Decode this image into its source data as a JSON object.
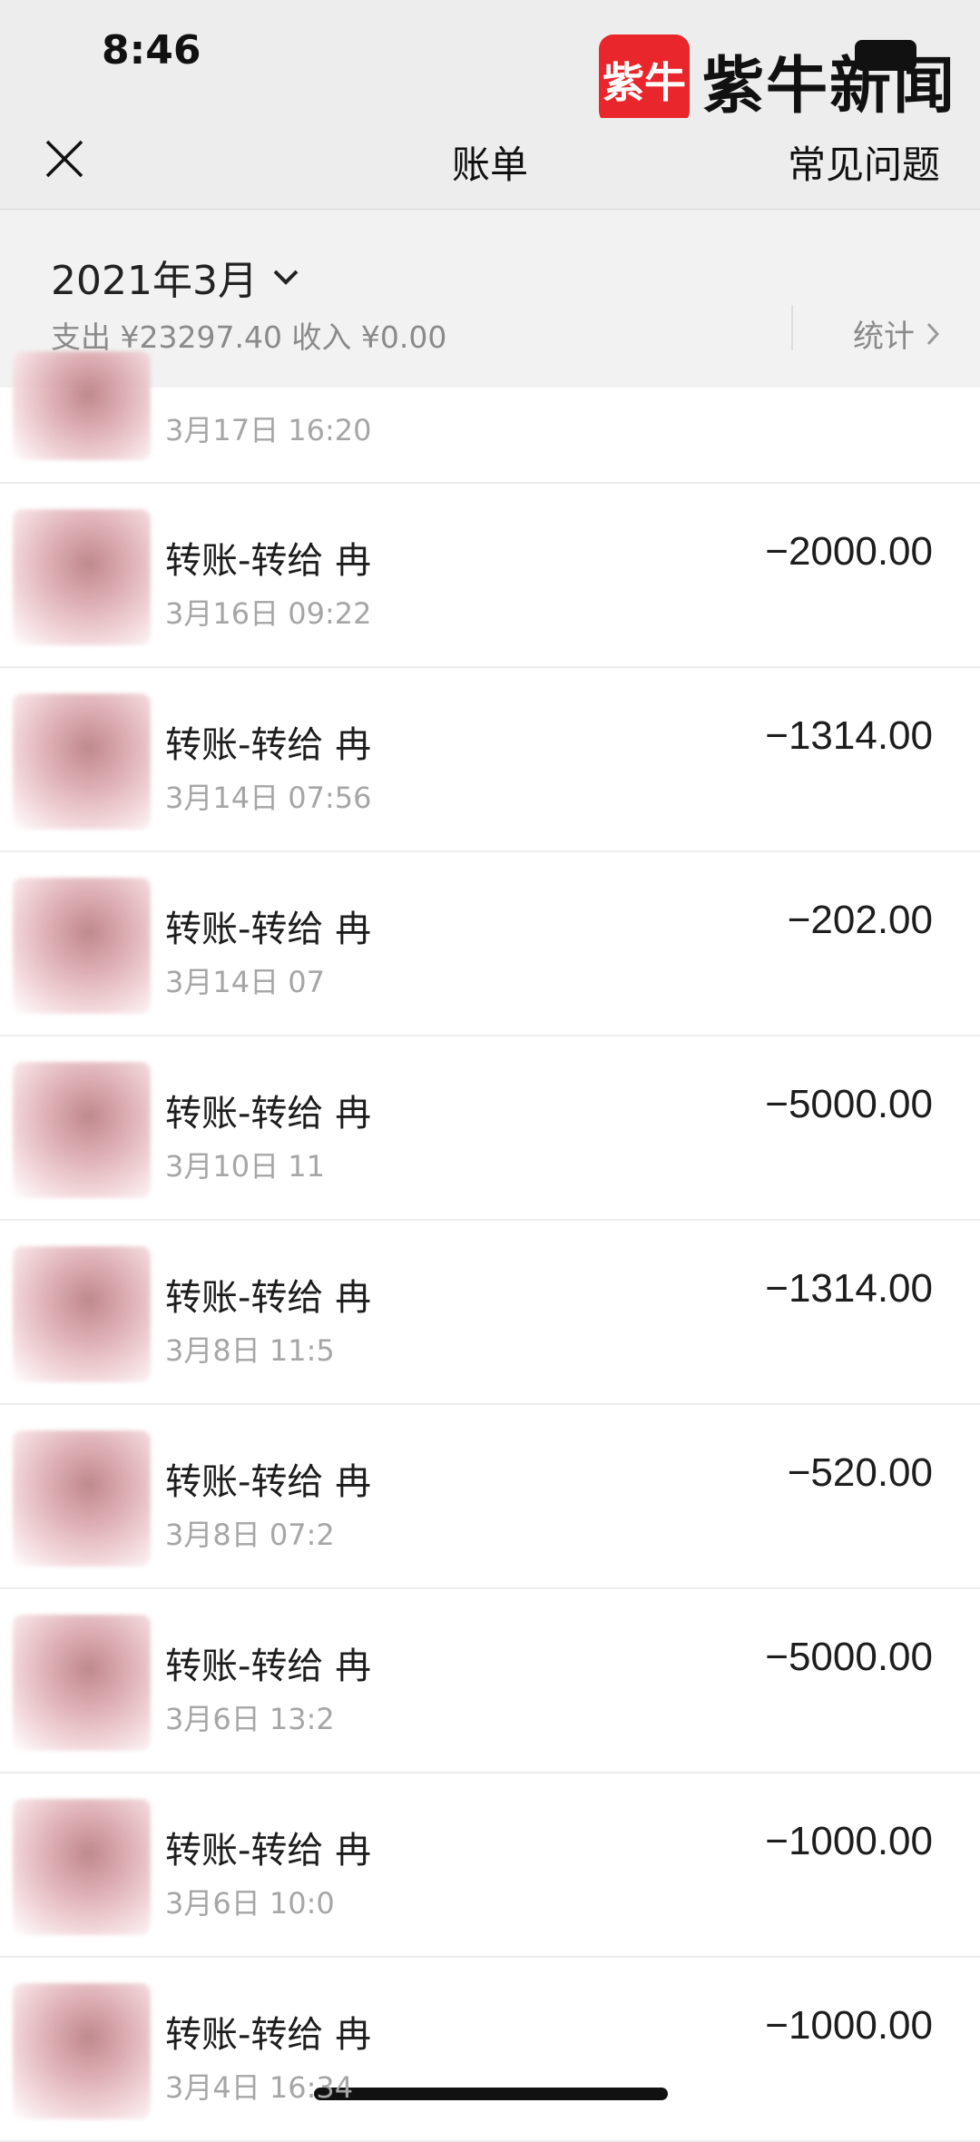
{
  "status_bar": {
    "time": "8:46"
  },
  "watermark": {
    "logo_text": "紫牛",
    "text": "紫牛新闻"
  },
  "nav": {
    "title": "账单",
    "faq": "常见问题"
  },
  "summary": {
    "month": "2021年3月",
    "totals": "支出 ¥23297.40 收入 ¥0.00",
    "stats": "统计"
  },
  "transactions": [
    {
      "title": "",
      "time": "3月17日 16:20",
      "amount": ""
    },
    {
      "title": "转账-转给 冉",
      "time": "3月16日 09:22",
      "amount": "−2000.00"
    },
    {
      "title": "转账-转给 冉",
      "time": "3月14日 07:56",
      "amount": "−1314.00"
    },
    {
      "title": "转账-转给 冉",
      "time": "3月14日 07",
      "amount": "−202.00"
    },
    {
      "title": "转账-转给 冉",
      "time": "3月10日 11",
      "amount": "−5000.00"
    },
    {
      "title": "转账-转给 冉",
      "time": "3月8日 11:5",
      "amount": "−1314.00"
    },
    {
      "title": "转账-转给 冉",
      "time": "3月8日 07:2",
      "amount": "−520.00"
    },
    {
      "title": "转账-转给 冉",
      "time": "3月6日 13:2",
      "amount": "−5000.00"
    },
    {
      "title": "转账-转给 冉",
      "time": "3月6日 10:0",
      "amount": "−1000.00"
    },
    {
      "title": "转账-转给 冉",
      "time": "3月4日 16:34",
      "amount": "−1000.00"
    }
  ]
}
